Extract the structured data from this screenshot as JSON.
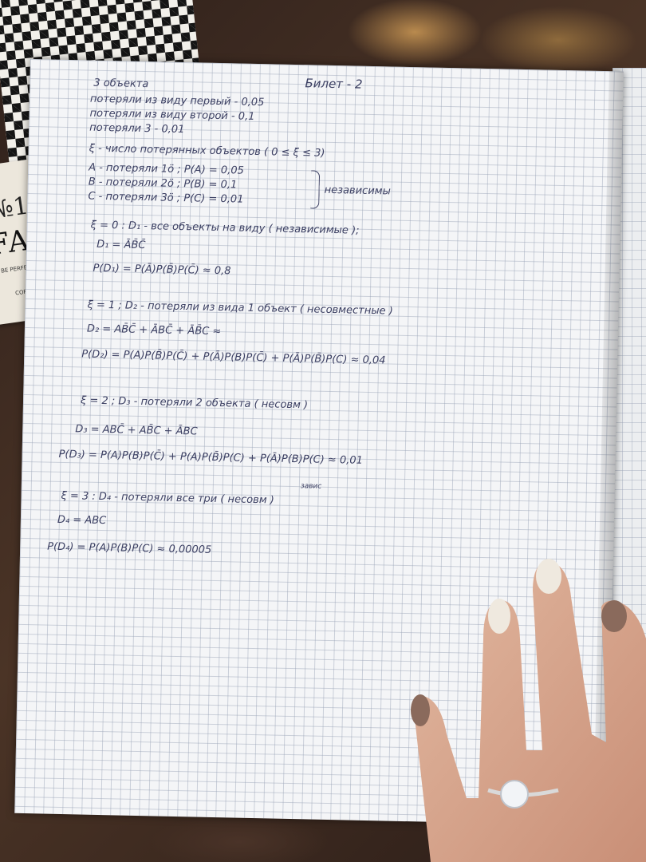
{
  "cover": {
    "number": "№1",
    "title": "FASHION",
    "subtitle": "BE PERFECT EVERY D",
    "copybook": "COPYBOO"
  },
  "notes": {
    "header": "Билет - 2",
    "lines": [
      "3 объекта",
      "потеряли из виду первый - 0,05",
      "потеряли из виду второй - 0,1",
      "потеряли 3 - 0,01",
      "ξ - число потерянных объектов ( 0 ≤ ξ ≤ 3)",
      "A - потеряли 1ö ; P(A) = 0,05",
      "B - потеряли 2ö ; P(B) = 0,1",
      "C - потеряли 3ö ; P(C) = 0,01",
      "независимы",
      "ξ = 0 : D₁ - все объекты на виду ( независимые );",
      "D₁ = ĀB̄C̄",
      "P(D₁) = P(Ā)P(B̄)P(C̄) ≈ 0,8",
      "ξ = 1 ; D₂ - потеряли из вида 1 объект ( несовместные )",
      "D₂ = AB̄C̄ + ĀBC̄ + ĀB̄C ≈",
      "P(D₂) = P(A)P(B̄)P(C̄) + P(Ā)P(B)P(C̄) + P(Ā)P(B̄)P(C) ≈ 0,04",
      "ξ = 2 ; D₃ - потеряли 2 объекта ( несовм )",
      "D₃ = ABC̄ + AB̄C + ĀBC",
      "P(D₃) = P(A)P(B)P(C̄) + P(A)P(B̄)P(C) + P(Ā)P(B)P(C) ≈ 0,01",
      "ξ = 3 : D₄ - потеряли все три ( несовм )",
      "завис",
      "D₄ = ABC",
      "P(D₄) = P(A)P(B)P(C) ≈ 0,00005"
    ]
  },
  "colors": {
    "ink": "#3b3f62",
    "paper": "#f4f5f7",
    "grid": "#96a0b4"
  }
}
